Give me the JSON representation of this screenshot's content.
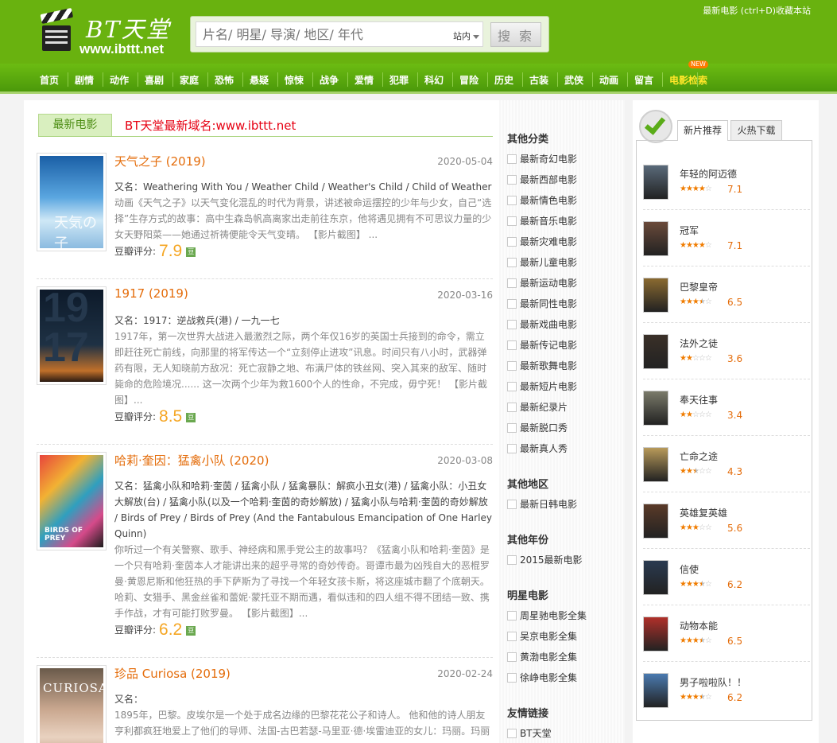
{
  "header": {
    "logo_name": "BT天堂",
    "logo_url": "www.ibttt.net",
    "search_placeholder": "片名/ 明星/ 导演/ 地区/ 年代",
    "search_scope": "站内",
    "search_button": "搜 索",
    "bookmark": "最新电影 (ctrl+D)收藏本站"
  },
  "nav": {
    "items": [
      "首页",
      "剧情",
      "动作",
      "喜剧",
      "家庭",
      "恐怖",
      "悬疑",
      "惊悚",
      "战争",
      "爱情",
      "犯罪",
      "科幻",
      "冒险",
      "历史",
      "古装",
      "武侠",
      "动画",
      "留言",
      "电影检索"
    ],
    "new_badge": "NEW"
  },
  "main": {
    "tab_label": "最新电影",
    "domain_note": "BT天堂最新域名:www.ibttt.net",
    "score_label": "豆瓣评分:",
    "movies": [
      {
        "title": "天气之子 (2019)",
        "date": "2020-05-04",
        "aka": "又名：Weathering With You / Weather Child / Weather's Child / Child of Weather",
        "desc": "动画《天气之子》以天气变化混乱的时代为背景，讲述被命运摆控的少年与少女，自己“选择”生存方式的故事：高中生森岛帆高离家出走前往东京，他将遇见拥有不可思议力量的少女天野阳菜——她通过祈祷便能令天气变晴。 【影片截图】 ...",
        "score": "7.9"
      },
      {
        "title": "1917 (2019)",
        "date": "2020-03-16",
        "aka": "又名：1917：逆战救兵(港) / 一九一七",
        "desc": "1917年，第一次世界大战进入最激烈之际，两个年仅16岁的英国士兵接到的命令，需立即赶往死亡前线，向那里的将军传达一个“立刻停止进攻”讯息。时间只有八小时，武器弹药有限，无人知晓前方敌况：死亡寂静之地、布满尸体的铁丝网、突入其来的敌军、随时毙命的危险境况...... 这一次两个少年为救1600个人的性命，不完成，毋宁死！ 【影片截图】...",
        "score": "8.5"
      },
      {
        "title": "哈莉·奎因：猛禽小队 (2020)",
        "date": "2020-03-08",
        "aka": "又名：猛禽小队和哈莉·奎茵 / 猛禽小队 / 猛禽暴队：解疯小丑女(港) / 猛禽小队：小丑女大解放(台) / 猛禽小队(以及一个哈莉·奎茵的奇妙解放) / 猛禽小队与哈莉·奎茵的奇妙解放 / Birds of Prey / Birds of Prey (And the Fantabulous Emancipation of One Harley Quinn)",
        "desc": "你听过一个有关警察、歌手、神经病和黑手党公主的故事吗？《猛禽小队和哈莉·奎茵》是一个只有哈莉·奎茵本人才能讲出来的超乎寻常的奇妙传奇。哥谭市最为凶残自大的恶棍罗曼·黄恩尼斯和他狂热的手下萨斯为了寻找一个年轻女孩卡斯，将这座城市翻了个底朝天。哈莉、女猎手、黑金丝雀和蕾妮·蒙托亚不期而遇，看似违和的四人组不得不团结一致、携手作战，才有可能打败罗曼。 【影片截图】...",
        "score": "6.2"
      },
      {
        "title": "珍品 Curiosa (2019)",
        "date": "2020-02-24",
        "aka": "又名：",
        "desc": "1895年，巴黎。皮埃尔是一个处于成名边缘的巴黎花花公子和诗人。 他和他的诗人朋友亨利都疯狂地爱上了他们的导师、法国-古巴若瑟-马里亚·德·埃雷迪亚的女儿：玛丽。玛丽",
        "score": ""
      }
    ]
  },
  "categories": {
    "groups": [
      {
        "title": "其他分类",
        "items": [
          "最新奇幻电影",
          "最新西部电影",
          "最新情色电影",
          "最新音乐电影",
          "最新灾难电影",
          "最新儿童电影",
          "最新运动电影",
          "最新同性电影",
          "最新戏曲电影",
          "最新传记电影",
          "最新歌舞电影",
          "最新短片电影",
          "最新纪录片",
          "最新脱口秀",
          "最新真人秀"
        ]
      },
      {
        "title": "其他地区",
        "items": [
          "最新日韩电影"
        ]
      },
      {
        "title": "其他年份",
        "items": [
          "2015最新电影"
        ]
      },
      {
        "title": "明星电影",
        "items": [
          "周星驰电影全集",
          "吴京电影全集",
          "黄渤电影全集",
          "徐峥电影全集"
        ]
      },
      {
        "title": "友情链接",
        "items": [
          "BT天堂"
        ]
      }
    ]
  },
  "sidebar": {
    "tab_active": "新片推荐",
    "tab_inactive": "火热下载",
    "items": [
      {
        "name": "年轻的阿迈德",
        "stars": 4,
        "rating": "7.1",
        "color": "#5a6a7a"
      },
      {
        "name": "冠军",
        "stars": 4,
        "rating": "7.1",
        "color": "#6a4a3a"
      },
      {
        "name": "巴黎皇帝",
        "stars": 3.5,
        "rating": "6.5",
        "color": "#8a6a30"
      },
      {
        "name": "法外之徒",
        "stars": 2,
        "rating": "3.6",
        "color": "#3a3028"
      },
      {
        "name": "奉天往事",
        "stars": 2,
        "rating": "3.4",
        "color": "#7a7a6a"
      },
      {
        "name": "亡命之途",
        "stars": 2.5,
        "rating": "4.3",
        "color": "#b89a5a"
      },
      {
        "name": "英雄复英雄",
        "stars": 3,
        "rating": "5.6",
        "color": "#5a3a28"
      },
      {
        "name": "信使",
        "stars": 3.5,
        "rating": "6.2",
        "color": "#2a3a50"
      },
      {
        "name": "动物本能",
        "stars": 3.5,
        "rating": "6.5",
        "color": "#b0302a"
      },
      {
        "name": "男子啦啦队！！",
        "stars": 3.5,
        "rating": "6.2",
        "color": "#4a7ab0"
      }
    ]
  }
}
